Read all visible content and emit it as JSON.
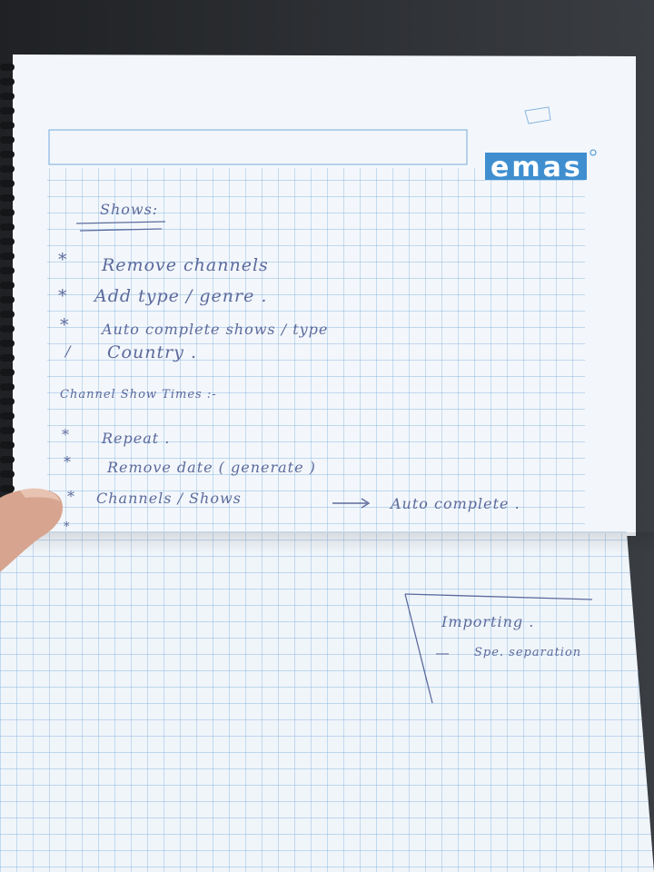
{
  "notebook": {
    "brand": "emas",
    "brand_color": "#3f8fd0",
    "grid_color": "#8bb7e0",
    "paper_color": "#f2f6fa",
    "ink_color": "#5c6a9c"
  },
  "notes": {
    "heading": "Shows:",
    "shows_items": [
      {
        "bullet": "*",
        "text": "Remove channels"
      },
      {
        "bullet": "*",
        "text": "Add type / genre ."
      },
      {
        "bullet": "*",
        "text": "Auto complete shows / type"
      },
      {
        "bullet": "/",
        "text": "Country ."
      }
    ],
    "channel_heading": "Channel Show Times :-",
    "channel_items": [
      {
        "bullet": "*",
        "text": "Repeat ."
      },
      {
        "bullet": "*",
        "text": "Remove date ( generate )"
      },
      {
        "bullet": "*",
        "text": "Channels / Shows"
      }
    ],
    "arrow_text": "Auto complete .",
    "trailing_bullet": "*",
    "box_title": "Importing .",
    "box_item": "Spe. separation"
  }
}
